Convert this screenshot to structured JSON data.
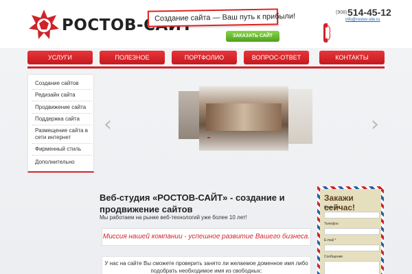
{
  "header": {
    "logo_text": "РОСТОВ-САЙТ",
    "slogan": "Создание сайта — Ваш путь к прибыли!",
    "order_button": "ЗАКАЗАТЬ САЙТ",
    "phone_prefix": "(908)",
    "phone_number": "514-45-12",
    "email": "info@rostov-site.ru"
  },
  "nav": {
    "items": [
      "УСЛУГИ",
      "ПОЛЕЗНОЕ",
      "ПОРТФОЛИО",
      "ВОПРОС-ОТВЕТ",
      "КОНТАКТЫ"
    ]
  },
  "sidebar": {
    "items": [
      "Создание сайтов",
      "Редизайн сайта",
      "Продвижение сайта",
      "Поддержка сайта",
      "Размещение сайта в сети интернет",
      "Фирменный стиль",
      "Дополнительно"
    ]
  },
  "slider": {
    "left_arrow": "‹",
    "right_arrow": "›"
  },
  "main": {
    "title": "Веб-студия «РОСТОВ-САЙТ» - создание и продвижение сайтов",
    "subtitle": "Мы работаем на рынке веб-технологий уже более 10 лет!",
    "mission": "Миссия нашей компании - успешное развитие Вашего бизнеса.",
    "domain_text": "У нас на сайте Вы сможете проверить занято ли желаемое доменное имя либо подобрать необходимое имя из свободных:"
  },
  "order_form": {
    "title": "Закажи сейчас!",
    "labels": [
      "Ваше имя *",
      "Телефон",
      "E-mail *",
      "Сообщение"
    ]
  },
  "colors": {
    "brand_red": "#d0232a",
    "accent_green": "#4da21c"
  }
}
